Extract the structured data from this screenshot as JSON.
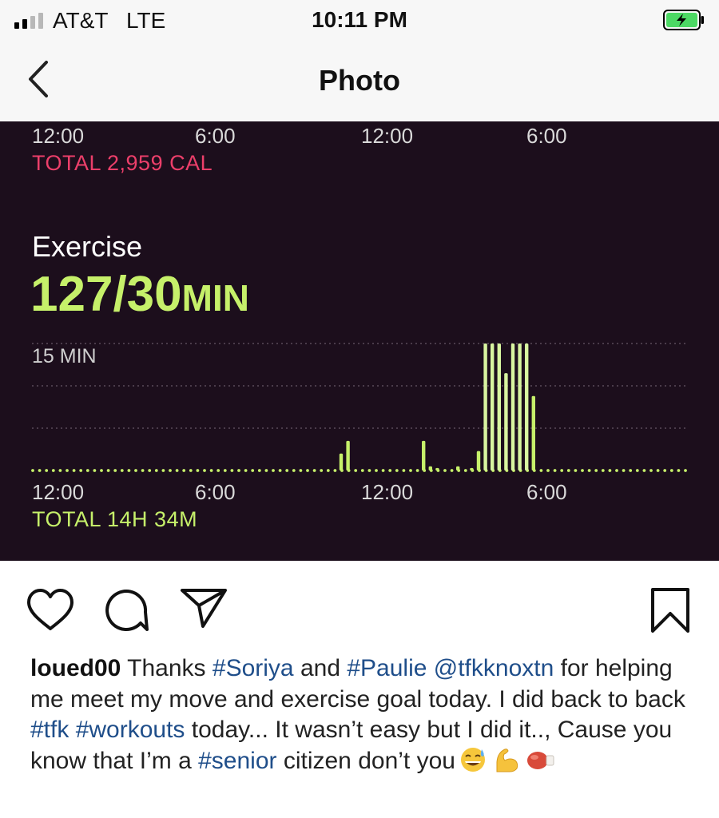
{
  "status_bar": {
    "carrier": "AT&T",
    "network": "LTE",
    "time": "10:11 PM",
    "battery_level": 0.85,
    "charging": true
  },
  "nav": {
    "title": "Photo",
    "back_icon": "chevron-left-icon"
  },
  "photo": {
    "calories_chart": {
      "x_ticks": [
        "12:00",
        "6:00",
        "12:00",
        "6:00"
      ],
      "total": "TOTAL 2,959 CAL",
      "accent": "#ec3f6a"
    },
    "exercise": {
      "label": "Exercise",
      "value": "127/30",
      "unit": "MIN",
      "accent": "#c6f06a"
    }
  },
  "chart_data": {
    "type": "bar",
    "title": "Exercise",
    "ylabel": "",
    "y_max_label": "15 MIN",
    "ylim": [
      0,
      15
    ],
    "x_ticks": [
      "12:00",
      "6:00",
      "12:00",
      "6:00"
    ],
    "x_tick_hours": [
      0,
      6,
      12,
      18
    ],
    "total": "TOTAL 14H 34M",
    "series": [
      {
        "values_by_hour": [
          {
            "hour": 11.25,
            "minutes": 2.0
          },
          {
            "hour": 11.5,
            "minutes": 3.5
          },
          {
            "hour": 14.25,
            "minutes": 3.5
          },
          {
            "hour": 14.5,
            "minutes": 0.5
          },
          {
            "hour": 14.75,
            "minutes": 0.3
          },
          {
            "hour": 15.5,
            "minutes": 0.5
          },
          {
            "hour": 16.0,
            "minutes": 0.3
          },
          {
            "hour": 16.25,
            "minutes": 2.3
          },
          {
            "hour": 16.5,
            "minutes": 15
          },
          {
            "hour": 16.75,
            "minutes": 15
          },
          {
            "hour": 17.0,
            "minutes": 15
          },
          {
            "hour": 17.25,
            "minutes": 11.5
          },
          {
            "hour": 17.5,
            "minutes": 15
          },
          {
            "hour": 17.75,
            "minutes": 15
          },
          {
            "hour": 18.0,
            "minutes": 15
          },
          {
            "hour": 18.25,
            "minutes": 8.8
          }
        ]
      }
    ]
  },
  "actions": {
    "like_icon": "heart-icon",
    "comment_icon": "comment-icon",
    "share_icon": "paper-plane-icon",
    "save_icon": "bookmark-icon"
  },
  "caption": {
    "username": "loued00",
    "t1": " Thanks ",
    "tag1": "#Soriya",
    "t2": " and ",
    "tag2": "#Paulie",
    "t3": " ",
    "mention": "@tfkknoxtn",
    "t4": " for helping me meet my move and exercise goal today. I did back to back ",
    "tag3": "#tfk",
    "t5": " ",
    "tag4": "#workouts",
    "t6": " today... It wasn’t easy but I did it.., Cause you know that I’m a ",
    "tag5": "#senior",
    "t7": " citizen don’t you",
    "emojis": [
      "sweat-smile-emoji",
      "flexed-biceps-emoji",
      "boxing-glove-emoji"
    ]
  }
}
